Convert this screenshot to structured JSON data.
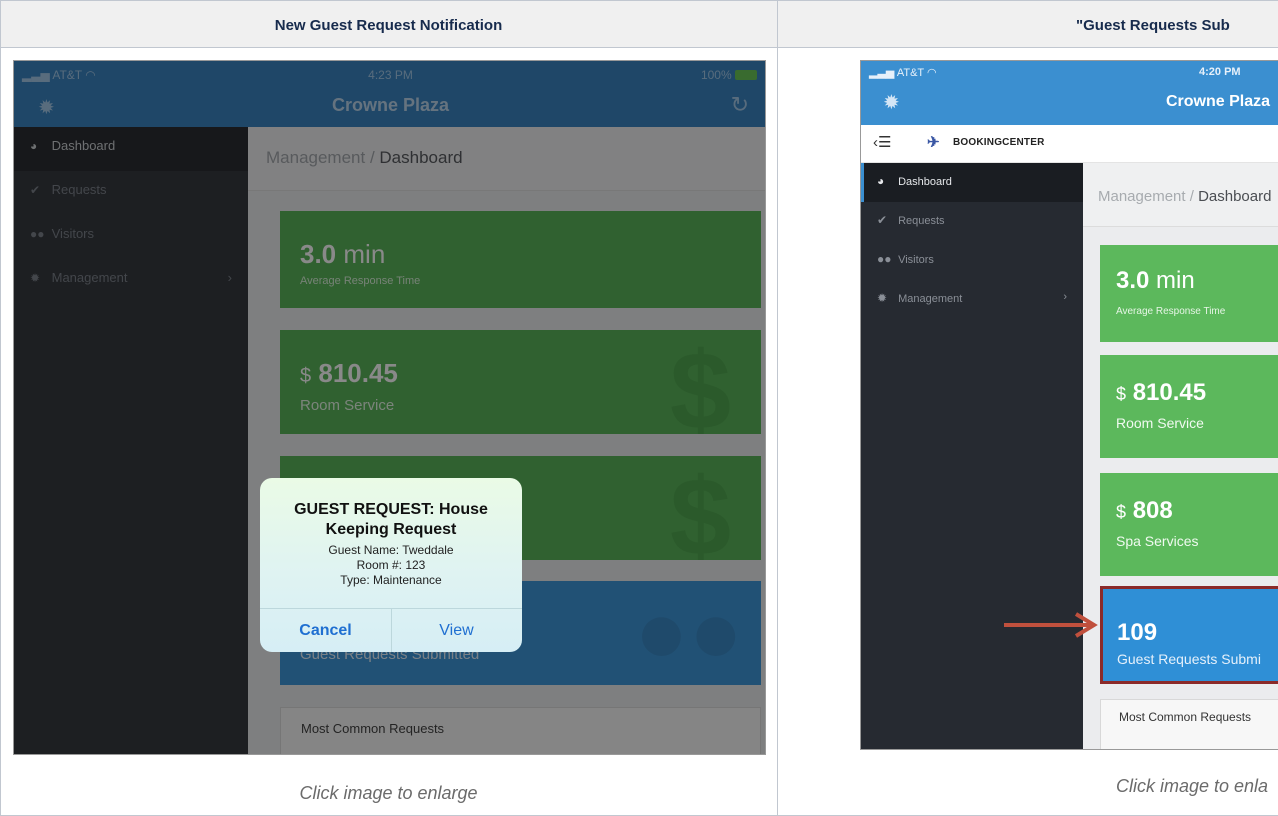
{
  "table": {
    "left_header": "New Guest Request Notification",
    "right_header": "\"Guest Requests Sub",
    "left_caption": "Click image to enlarge",
    "right_caption": "Click image to enla"
  },
  "left_screen": {
    "status": {
      "carrier": "AT&T",
      "time": "4:23 PM",
      "battery": "100%"
    },
    "nav_title": "Crowne Plaza",
    "sidebar": [
      {
        "label": "Dashboard",
        "icon": "dashboard-icon"
      },
      {
        "label": "Requests",
        "icon": "check-icon"
      },
      {
        "label": "Visitors",
        "icon": "users-icon"
      },
      {
        "label": "Management",
        "icon": "gear-icon"
      }
    ],
    "breadcrumb": {
      "parent": "Management / ",
      "current": "Dashboard"
    },
    "tiles": {
      "response": {
        "value": "3.0",
        "unit": "min",
        "label": "Average Response Time"
      },
      "room": {
        "currency": "$",
        "value": "810.45",
        "label": "Room Service"
      },
      "requests": {
        "label": "Guest Requests Submitted"
      }
    },
    "common_requests": "Most Common Requests",
    "alert": {
      "title_line1": "GUEST REQUEST: House",
      "title_line2": "Keeping Request",
      "guest_name": "Guest Name: Tweddale",
      "room": "Room #: 123",
      "type": "Type: Maintenance",
      "cancel": "Cancel",
      "view": "View"
    }
  },
  "right_screen": {
    "status": {
      "carrier": "AT&T",
      "time": "4:20 PM"
    },
    "nav_title": "Crowne Plaza",
    "brand": "BOOKINGCENTER",
    "sidebar": [
      {
        "label": "Dashboard"
      },
      {
        "label": "Requests"
      },
      {
        "label": "Visitors"
      },
      {
        "label": "Management"
      }
    ],
    "breadcrumb": {
      "parent": "Management / ",
      "current": "Dashboard"
    },
    "tiles": {
      "response": {
        "value": "3.0",
        "unit": "min",
        "label": "Average Response Time"
      },
      "room": {
        "currency": "$",
        "value": "810.45",
        "label": "Room Service"
      },
      "spa": {
        "currency": "$",
        "value": "808",
        "label": "Spa Services"
      },
      "requests": {
        "value": "109",
        "label": "Guest Requests Submi"
      }
    },
    "common_requests": "Most Common Requests"
  },
  "colors": {
    "tile_green": "#4cae4c",
    "tile_blue": "#2f8fd6",
    "nav_blue": "#3b8fd0",
    "sidebar_dark": "#262a31",
    "highlight_red": "#8b2a2a"
  }
}
